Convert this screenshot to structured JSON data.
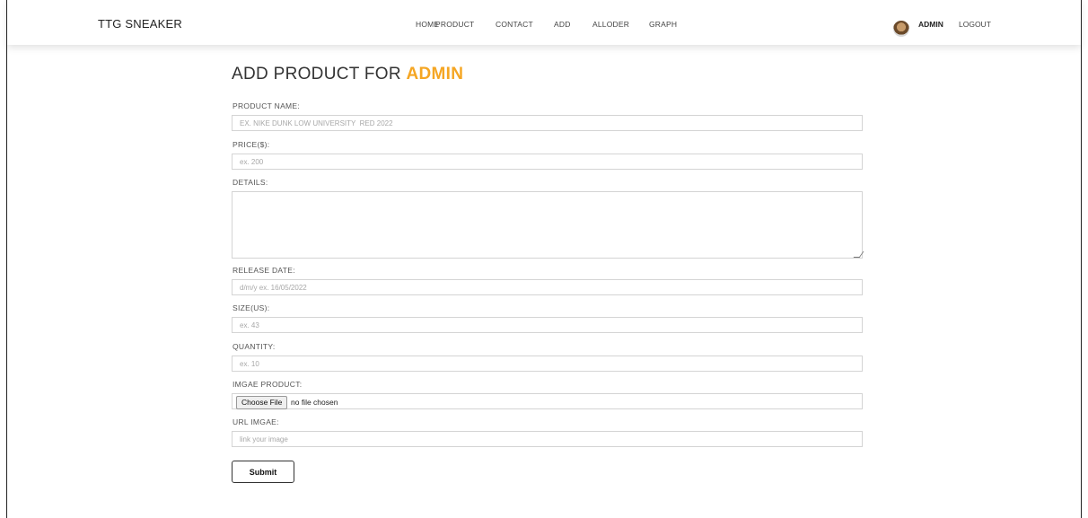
{
  "navbar": {
    "brand": "TTG SNEAKER",
    "links": [
      "HOME",
      "PRODUCT",
      "CONTACT",
      "ADD",
      "ALLODER",
      "GRAPH"
    ],
    "user": {
      "name": "ADMIN",
      "logout": "LOGOUT"
    }
  },
  "page": {
    "title_prefix": "ADD PRODUCT FOR ",
    "title_highlight": "ADMIN",
    "accent_color": "#f5a623"
  },
  "form": {
    "product_name": {
      "label": "PRODUCT NAME:",
      "placeholder": "EX. NIKE DUNK LOW UNIVERSITY  RED 2022"
    },
    "price": {
      "label": "PRICE($):",
      "placeholder": "ex. 200"
    },
    "details": {
      "label": "DETAILS:"
    },
    "release_date": {
      "label": "RELEASE DATE:",
      "placeholder": "d/m/y ex. 16/05/2022"
    },
    "size": {
      "label": "SIZE(US):",
      "placeholder": "ex. 43"
    },
    "quantity": {
      "label": "QUANTITY:",
      "placeholder": "ex. 10"
    },
    "image_product": {
      "label": "IMGAE PRODUCT:",
      "button": "Choose File",
      "status": "no file chosen"
    },
    "url_image": {
      "label": "URL IMGAE:",
      "placeholder": "link your image"
    },
    "submit": "Submit"
  }
}
